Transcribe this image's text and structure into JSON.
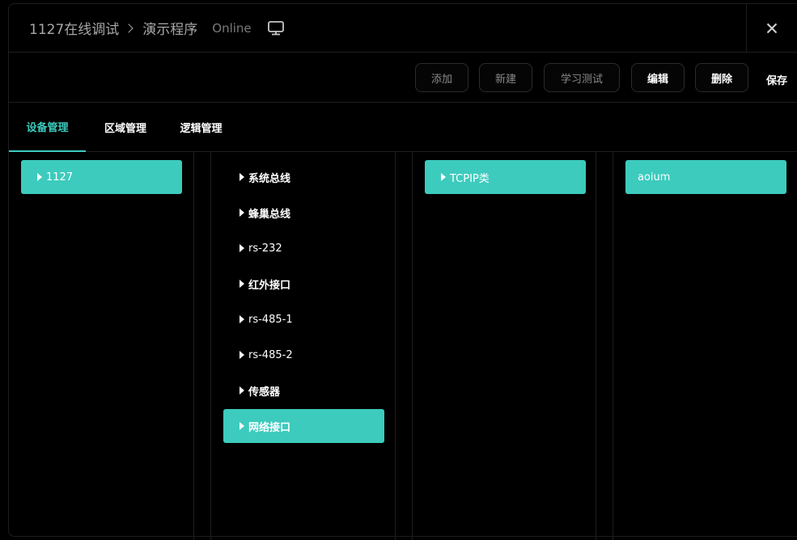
{
  "header": {
    "project": "1127在线调试",
    "program": "演示程序",
    "status": "Online",
    "monitor_icon": "monitor-icon",
    "close_icon": "close-icon"
  },
  "toolbar": {
    "add_label": "添加",
    "new_label": "新建",
    "learn_test_label": "学习测试",
    "edit_label": "编辑",
    "delete_label": "删除",
    "save_label": "保存"
  },
  "tabs": [
    {
      "label": "设备管理",
      "active": true
    },
    {
      "label": "区域管理",
      "active": false
    },
    {
      "label": "逻辑管理",
      "active": false
    }
  ],
  "columns": {
    "devices": [
      {
        "label": "1127",
        "selected": true
      }
    ],
    "buses": [
      {
        "label": "系统总线",
        "selected": false
      },
      {
        "label": "蜂巢总线",
        "selected": false
      },
      {
        "label": "rs-232",
        "selected": false
      },
      {
        "label": "红外接口",
        "selected": false
      },
      {
        "label": "rs-485-1",
        "selected": false
      },
      {
        "label": "rs-485-2",
        "selected": false
      },
      {
        "label": "传感器",
        "selected": false
      },
      {
        "label": "网络接口",
        "selected": true
      }
    ],
    "categories": [
      {
        "label": "TCPIP类",
        "selected": true
      }
    ],
    "instances": [
      {
        "label": "aoium",
        "selected": true
      }
    ]
  },
  "colors": {
    "accent": "#3ccbbd",
    "background": "#000000",
    "border": "#1e1e1e"
  }
}
